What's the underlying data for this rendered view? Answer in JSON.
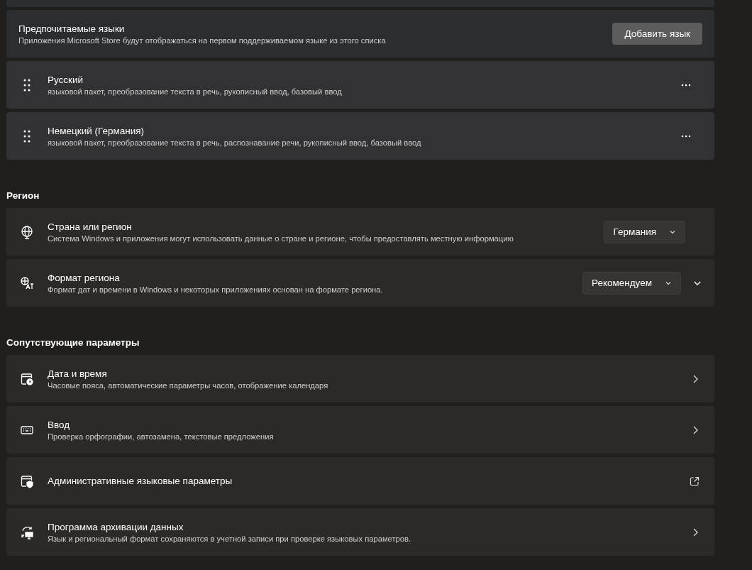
{
  "preferred_languages": {
    "title": "Предпочитаемые языки",
    "description": "Приложения Microsoft Store будут отображаться на первом поддерживаемом языке из этого списка",
    "add_button": "Добавить язык"
  },
  "languages": [
    {
      "name": "Русский",
      "features": "языковой пакет, преобразование текста в речь, рукописный ввод, базовый ввод"
    },
    {
      "name": "Немецкий (Германия)",
      "features": "языковой пакет, преобразование текста в речь, распознавание речи, рукописный ввод, базовый ввод"
    }
  ],
  "region": {
    "heading": "Регион",
    "items": [
      {
        "title": "Страна или регион",
        "description": "Система Windows и приложения могут использовать данные о стране и регионе, чтобы предоставлять местную информацию",
        "dropdown": "Германия"
      },
      {
        "title": "Формат региона",
        "description": "Формат дат и времени в Windows и некоторых приложениях основан на формате региона.",
        "dropdown": "Рекомендуем",
        "expanded": false
      }
    ]
  },
  "related": {
    "heading": "Сопутствующие параметры",
    "items": [
      {
        "kind": "navigate",
        "title": "Дата и время",
        "description": "Часовые пояса, автоматические параметры часов, отображение календаря"
      },
      {
        "kind": "navigate",
        "title": "Ввод",
        "description": "Проверка орфографии, автозамена, текстовые предложения"
      },
      {
        "kind": "external",
        "title": "Административные языковые параметры"
      },
      {
        "kind": "navigate",
        "title": "Программа архивации данных",
        "description": "Язык и региональный формат сохраняются в учетной записи при проверке языковых параметров."
      }
    ]
  }
}
